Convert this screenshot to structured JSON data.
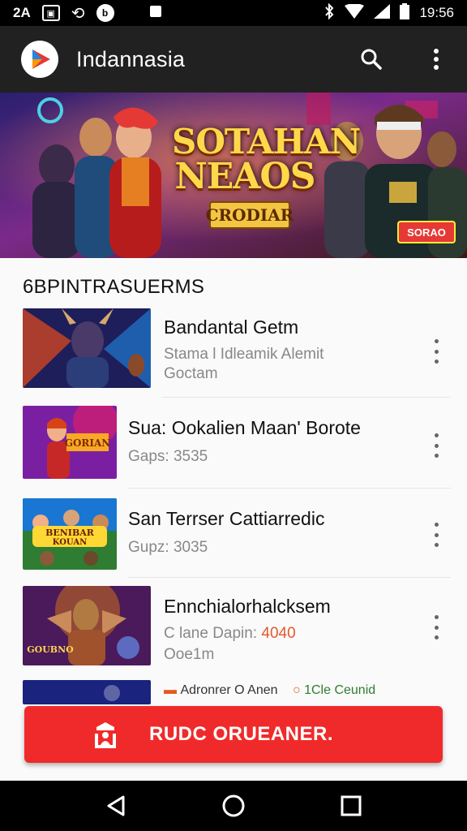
{
  "status_bar": {
    "left_text": "2A",
    "time": "19:56"
  },
  "app_bar": {
    "title": "Indannasia"
  },
  "banner": {
    "title_line1": "SOTAHAN",
    "title_line2": "NEAOS",
    "subtitle": "CRODIAR",
    "cta_label": "SORAO"
  },
  "section": {
    "title": "6BPINTRASUERMS"
  },
  "items": [
    {
      "title": "Bandantal Getm",
      "sub1": "Stama l Idleamik Alemit",
      "sub2": "Goctam"
    },
    {
      "title": "Sua: Ookalien Maan' Borote",
      "sub1": "Gaps: 3535",
      "sub2": ""
    },
    {
      "title": "San Terrser Cattiarredic",
      "sub1": "Gupz: 3035",
      "sub2": ""
    },
    {
      "title": "Ennchialorhalcksem",
      "sub1_prefix": "C lane Dapin: ",
      "sub1_accent": "4040",
      "sub2": "Ooe1m"
    }
  ],
  "partial_row": {
    "text1": "Adronrer O Anen",
    "text2": "1Cle Ceunid"
  },
  "bottom_cta": {
    "label": "RUDC ORUEANER."
  },
  "colors": {
    "app_bar_bg": "#212121",
    "status_bar_bg": "#000000",
    "cta_red": "#f02a2a",
    "accent_orange": "#e2582b"
  }
}
